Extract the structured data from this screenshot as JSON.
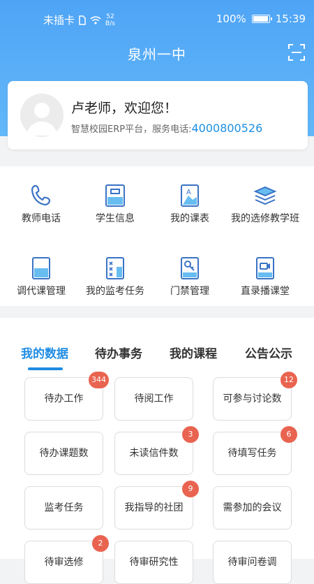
{
  "status_bar": {
    "carrier": "未插卡",
    "speed_value": "52",
    "speed_unit": "B/s",
    "battery": "100%",
    "battery_level": 1.0,
    "time": "15:39"
  },
  "header": {
    "title": "泉州一中"
  },
  "profile": {
    "greeting": "卢老师，欢迎您！",
    "service_text": "智慧校园ERP平台，服务电话:",
    "phone": "4000800526"
  },
  "menu": {
    "items": [
      {
        "label": "教师电话",
        "icon": "phone-icon"
      },
      {
        "label": "学生信息",
        "icon": "student-info-icon"
      },
      {
        "label": "我的课表",
        "icon": "timetable-icon"
      },
      {
        "label": "我的选修教学班",
        "icon": "books-icon"
      },
      {
        "label": "调代课管理",
        "icon": "folder-icon"
      },
      {
        "label": "我的监考任务",
        "icon": "exam-icon"
      },
      {
        "label": "门禁管理",
        "icon": "access-key-icon"
      },
      {
        "label": "直录播课堂",
        "icon": "video-icon"
      }
    ]
  },
  "tabs": [
    {
      "label": "我的数据",
      "active": true
    },
    {
      "label": "待办事务",
      "active": false
    },
    {
      "label": "我的课程",
      "active": false
    },
    {
      "label": "公告公示",
      "active": false
    }
  ],
  "tiles": [
    {
      "label": "待办工作",
      "badge": "344"
    },
    {
      "label": "待阅工作",
      "badge": ""
    },
    {
      "label": "可参与讨论数",
      "badge": "12"
    },
    {
      "label": "待办课题数",
      "badge": ""
    },
    {
      "label": "未读信件数",
      "badge": "3"
    },
    {
      "label": "待填写任务",
      "badge": "6"
    },
    {
      "label": "监考任务",
      "badge": ""
    },
    {
      "label": "我指导的社团",
      "badge": "9"
    },
    {
      "label": "需参加的会议",
      "badge": ""
    },
    {
      "label": "待审选修",
      "badge": "2"
    },
    {
      "label": "待审研究性",
      "badge": ""
    },
    {
      "label": "待审问卷调",
      "badge": ""
    }
  ],
  "colors": {
    "header_blue": "#4fa4f6",
    "accent_blue": "#1f8ce3",
    "badge_red": "#e96450"
  }
}
